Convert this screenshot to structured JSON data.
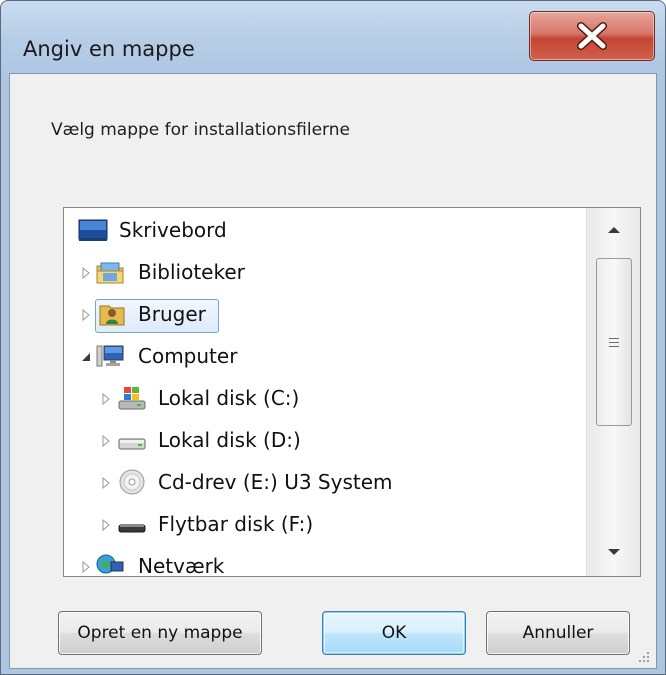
{
  "window": {
    "title": "Angiv en mappe",
    "close_label": "Luk"
  },
  "dialog": {
    "instruction": "Vælg mappe for installationsfilerne"
  },
  "tree": {
    "items": [
      {
        "label": "Skrivebord",
        "icon": "desktop-icon",
        "expanded": false
      },
      {
        "label": "Biblioteker",
        "icon": "libraries-icon",
        "expanded": false
      },
      {
        "label": "Bruger",
        "icon": "user-folder-icon",
        "expanded": false,
        "selected": true
      },
      {
        "label": "Computer",
        "icon": "computer-icon",
        "expanded": true
      },
      {
        "label": "Lokal disk (C:)",
        "icon": "windows-drive-icon",
        "expanded": false
      },
      {
        "label": "Lokal disk (D:)",
        "icon": "hard-drive-icon",
        "expanded": false
      },
      {
        "label": "Cd-drev (E:) U3 System",
        "icon": "cd-drive-icon",
        "expanded": false
      },
      {
        "label": "Flytbar disk (F:)",
        "icon": "removable-disk-icon",
        "expanded": false
      },
      {
        "label": "Netværk",
        "icon": "network-icon",
        "expanded": false
      }
    ]
  },
  "buttons": {
    "new_folder": "Opret en ny mappe",
    "ok": "OK",
    "cancel": "Annuller"
  },
  "colors": {
    "frame": "#b7cde6",
    "client": "#f0f0f0",
    "close_button": "#c54533",
    "selection": "#dcebfc",
    "default_button_border": "#3c7fb1"
  }
}
